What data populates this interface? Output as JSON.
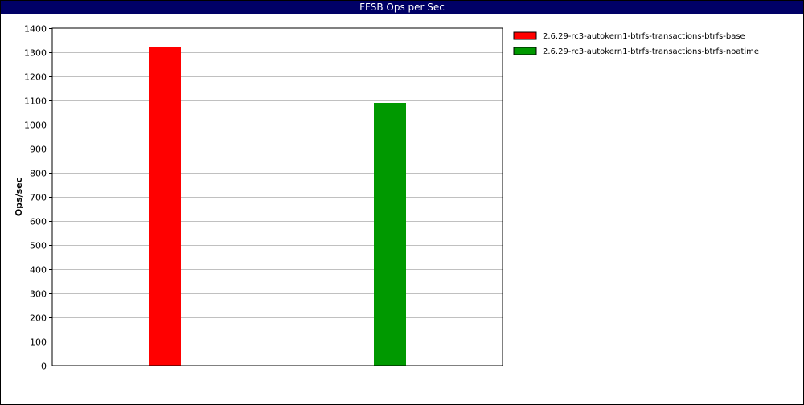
{
  "window": {
    "title": "FFSB Ops per Sec"
  },
  "chart_data": {
    "type": "bar",
    "title": "FFSB Ops per Sec",
    "xlabel": "",
    "ylabel": "Ops/sec",
    "ylim": [
      0,
      1400
    ],
    "yticks": [
      0,
      100,
      200,
      300,
      400,
      500,
      600,
      700,
      800,
      900,
      1000,
      1100,
      1200,
      1300,
      1400
    ],
    "grid": true,
    "legend_position": "right",
    "series": [
      {
        "name": "2.6.29-rc3-autokern1-btrfs-transactions-btrfs-base",
        "value": 1320,
        "color": "#ff0000"
      },
      {
        "name": "2.6.29-rc3-autokern1-btrfs-transactions-btrfs-noatime",
        "value": 1090,
        "color": "#009900"
      }
    ]
  }
}
